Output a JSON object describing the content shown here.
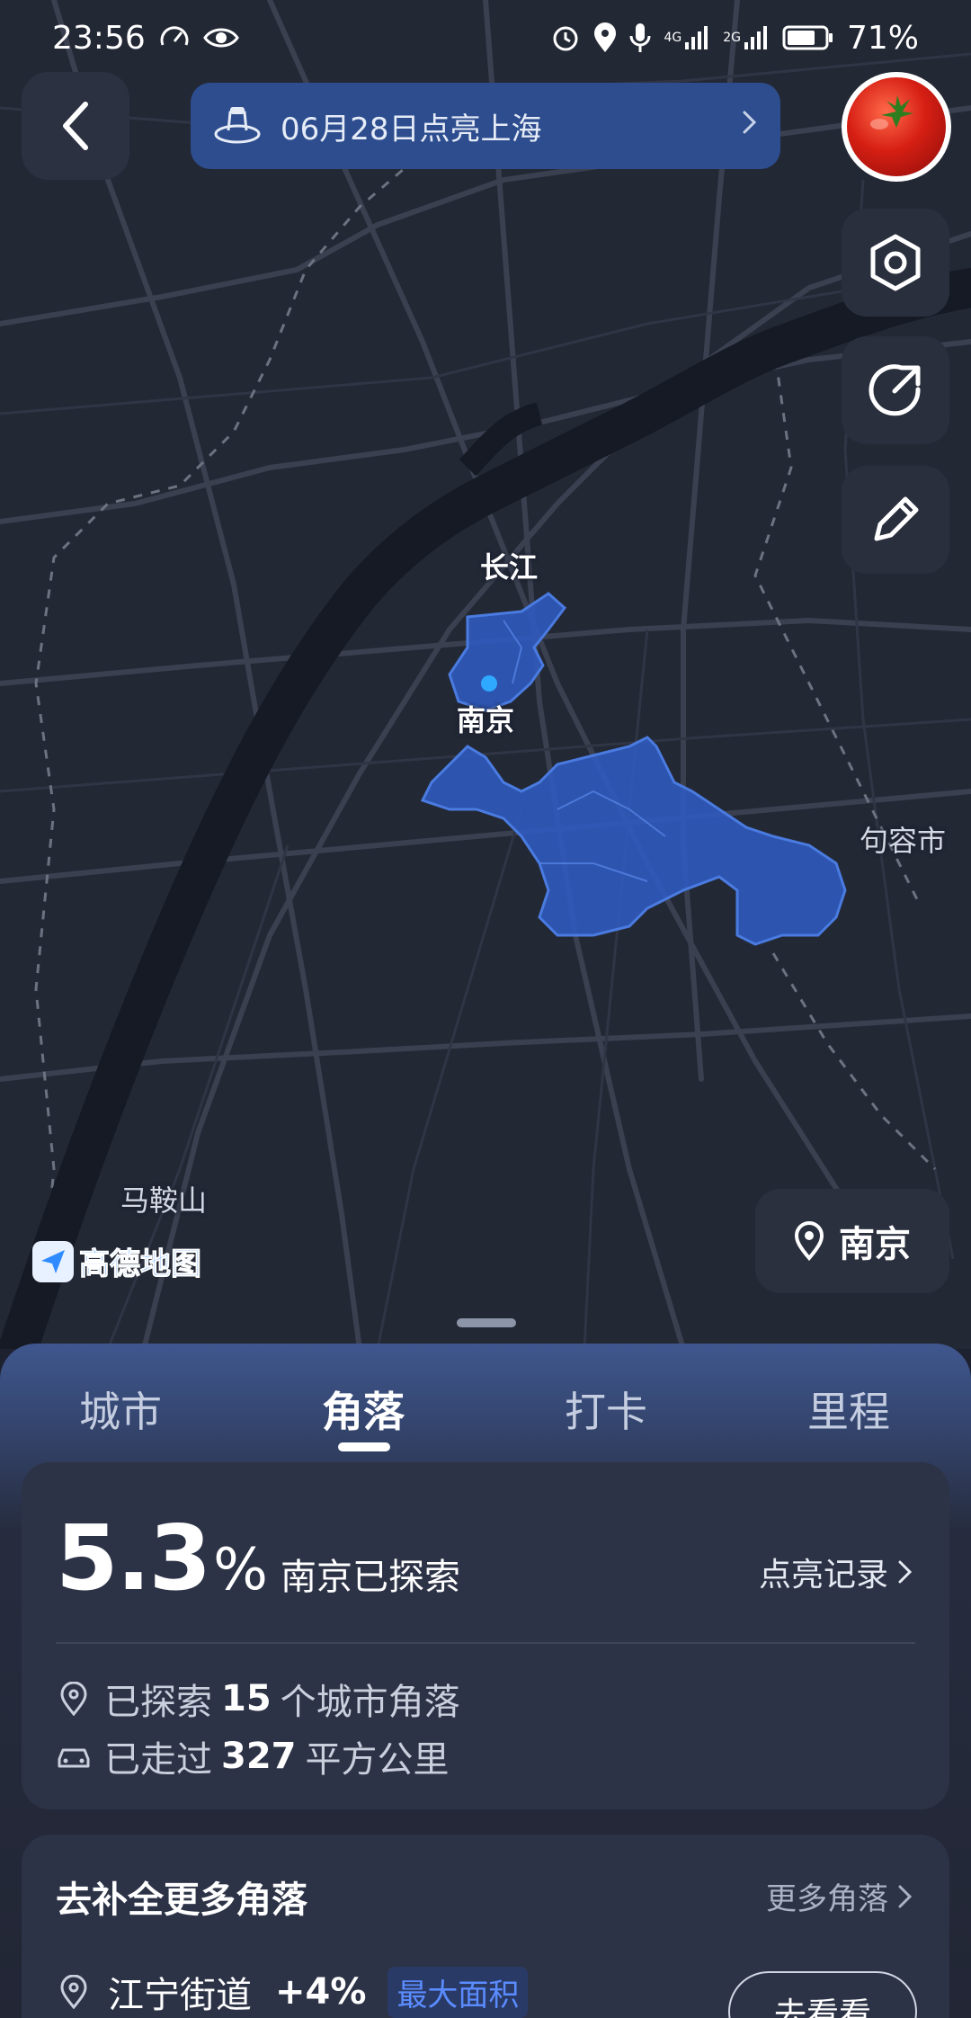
{
  "status_bar": {
    "time": "23:56",
    "battery": "71%",
    "network_4g": "4G",
    "network_2g": "2G"
  },
  "banner": {
    "text": "06月28日点亮上海"
  },
  "map": {
    "labels": {
      "yangtze": "长江",
      "nanjing": "南京",
      "jurong": "句容市",
      "maanshan": "马鞍山"
    },
    "logo_text": "高德地图",
    "city_button": "南京"
  },
  "tabs": [
    "城市",
    "角落",
    "打卡",
    "里程"
  ],
  "active_tab": "角落",
  "summary": {
    "percent": "5.3",
    "percent_sign": "%",
    "label": "南京已探索",
    "record_link": "点亮记录",
    "explored_prefix": "已探索",
    "explored_count": "15",
    "explored_suffix": "个城市角落",
    "walked_prefix": "已走过",
    "walked_area": "327",
    "walked_suffix": "平方公里"
  },
  "corners": {
    "title": "去补全更多角落",
    "more_link": "更多角落",
    "item": {
      "name": "江宁街道",
      "gain": "+4%",
      "tag": "最大面积",
      "button": "去看看"
    }
  },
  "colors": {
    "explored_region": "#2f5cc4",
    "banner_bg": "#2d4d8e",
    "map_bg": "#232835"
  }
}
